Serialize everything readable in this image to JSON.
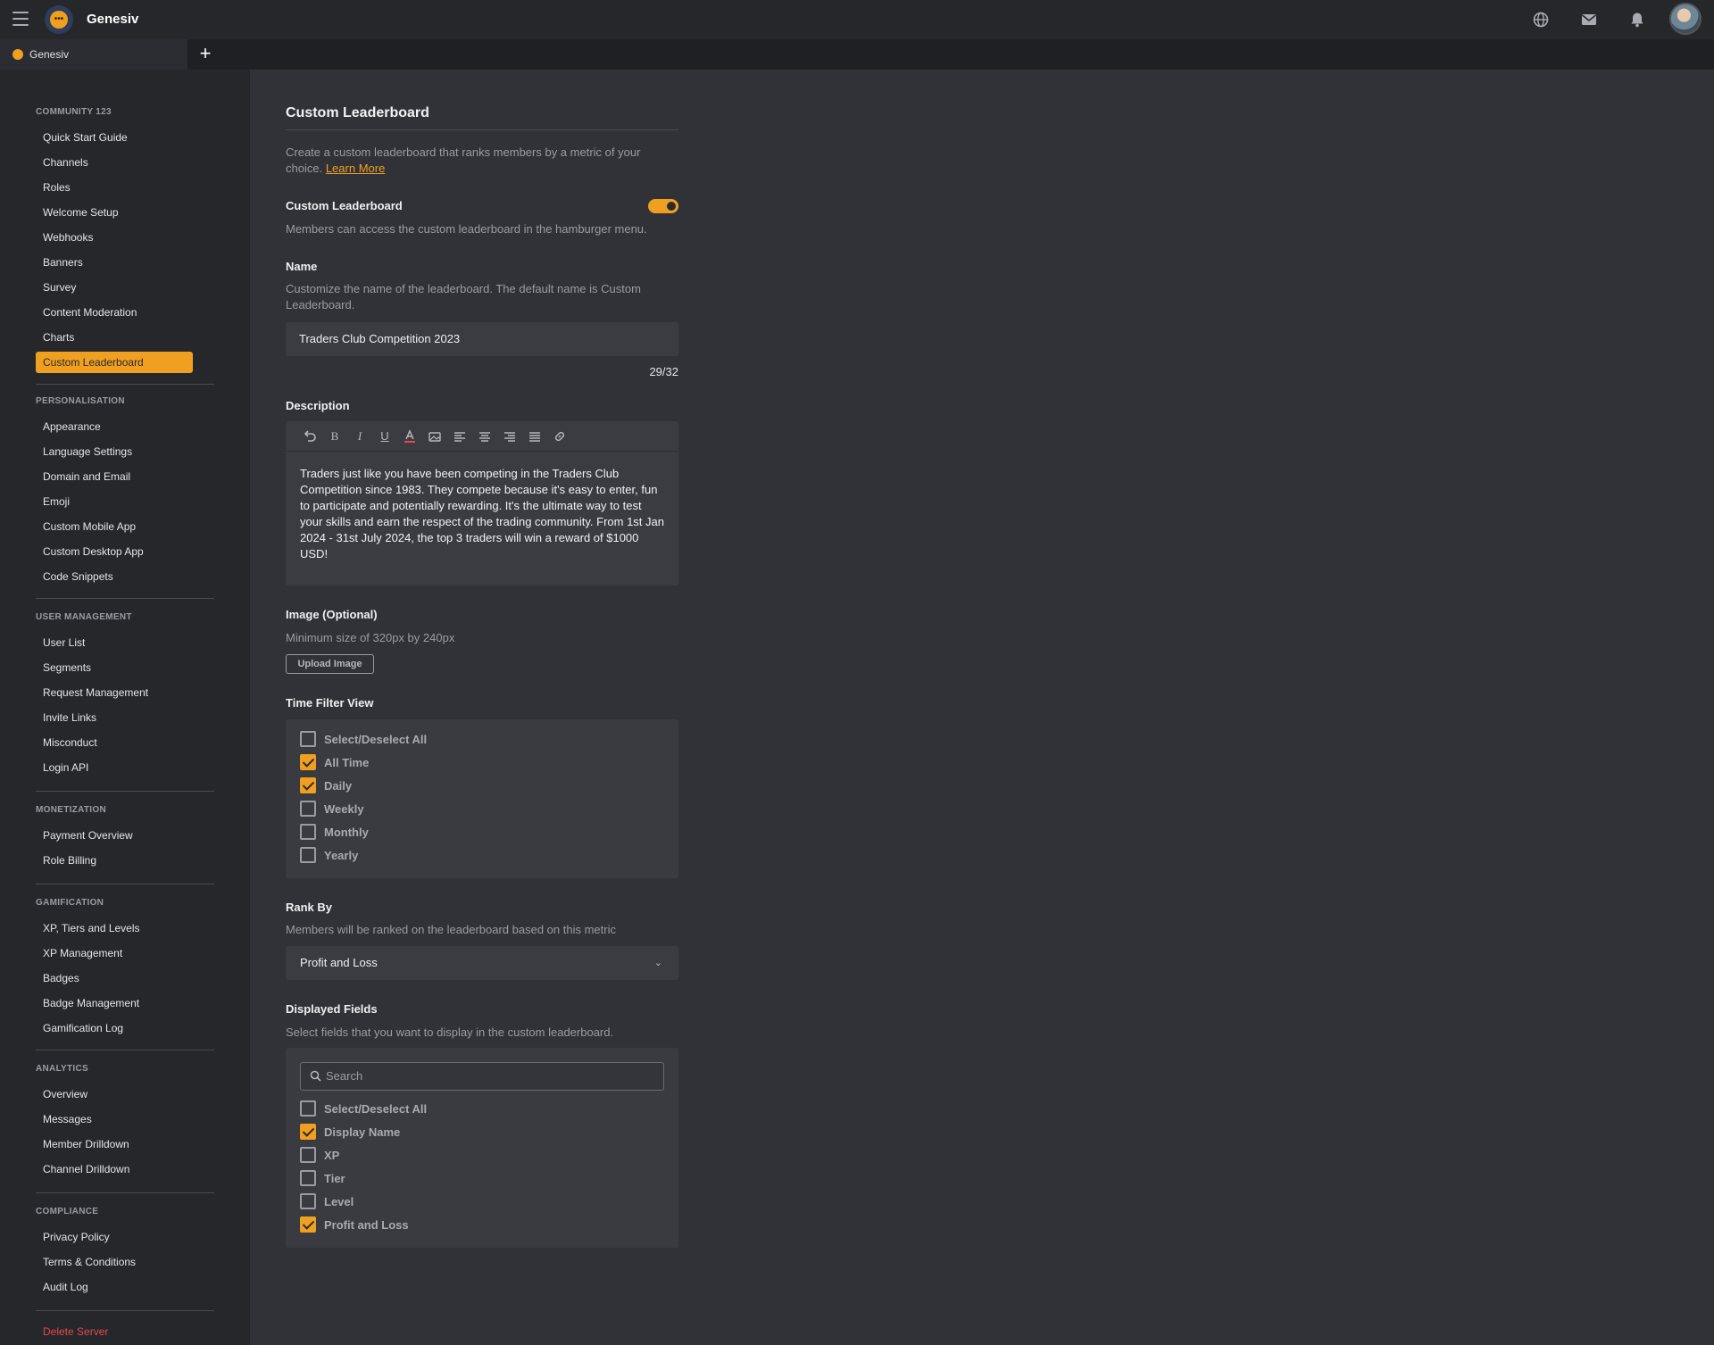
{
  "app": {
    "title": "Genesiv"
  },
  "tabs": [
    {
      "label": "Genesiv"
    }
  ],
  "header_icons": [
    "globe-icon",
    "mail-icon",
    "bell-icon",
    "avatar"
  ],
  "sidebar": {
    "community": {
      "title": "COMMUNITY 123",
      "items": [
        "Quick Start Guide",
        "Channels",
        "Roles",
        "Welcome Setup",
        "Webhooks",
        "Banners",
        "Survey",
        "Content Moderation",
        "Charts",
        "Custom Leaderboard"
      ]
    },
    "personalisation": {
      "title": "PERSONALISATION",
      "items": [
        "Appearance",
        "Language Settings",
        "Domain and Email",
        "Emoji",
        "Custom Mobile App",
        "Custom Desktop App",
        "Code Snippets"
      ]
    },
    "user_management": {
      "title": "USER MANAGEMENT",
      "items": [
        "User List",
        "Segments",
        "Request Management",
        "Invite Links",
        "Misconduct",
        "Login API"
      ]
    },
    "monetization": {
      "title": "MONETIZATION",
      "items": [
        "Payment Overview",
        "Role Billing"
      ]
    },
    "gamification": {
      "title": "GAMIFICATION",
      "items": [
        "XP, Tiers and Levels",
        "XP Management",
        "Badges",
        "Badge Management",
        "Gamification Log"
      ]
    },
    "analytics": {
      "title": "ANALYTICS",
      "items": [
        "Overview",
        "Messages",
        "Member Drilldown",
        "Channel Drilldown"
      ]
    },
    "compliance": {
      "title": "COMPLIANCE",
      "items": [
        "Privacy Policy",
        "Terms & Conditions",
        "Audit Log"
      ]
    },
    "delete": "Delete Server",
    "active_item": "Custom Leaderboard",
    "accent_color": "#f0a020"
  },
  "main": {
    "title": "Custom Leaderboard",
    "intro": "Create a custom leaderboard that ranks members by a metric of your choice.",
    "learn_more": "Learn More",
    "toggle": {
      "label": "Custom Leaderboard",
      "desc": "Members can access the custom leaderboard in the hamburger menu.",
      "enabled": true
    },
    "name": {
      "label": "Name",
      "desc": "Customize the name of the leaderboard. The default name is Custom Leaderboard.",
      "value": "Traders Club Competition 2023",
      "counter": "29/32"
    },
    "description": {
      "label": "Description",
      "toolbar": [
        "undo-icon",
        "bold-icon",
        "italic-icon",
        "underline-icon",
        "text-color-icon",
        "image-icon",
        "align-left-icon",
        "align-center-icon",
        "align-right-icon",
        "justify-icon",
        "link-icon"
      ],
      "text": "Traders just like you have been competing in the Traders Club Competition since 1983. They compete because it's easy to enter, fun to participate and potentially rewarding. It's the ultimate way to test your skills and earn the respect of the trading community. From 1st Jan 2024 - 31st July 2024, the top 3 traders will win a reward of $1000 USD!"
    },
    "image": {
      "label": "Image (Optional)",
      "desc": "Minimum size of 320px by 240px",
      "button": "Upload Image"
    },
    "time_filter": {
      "label": "Time Filter View",
      "options": [
        {
          "label": "Select/Deselect All",
          "checked": false
        },
        {
          "label": "All Time",
          "checked": true
        },
        {
          "label": "Daily",
          "checked": true
        },
        {
          "label": "Weekly",
          "checked": false
        },
        {
          "label": "Monthly",
          "checked": false
        },
        {
          "label": "Yearly",
          "checked": false
        }
      ]
    },
    "rank_by": {
      "label": "Rank By",
      "desc": "Members will be ranked on the leaderboard based on this metric",
      "value": "Profit and Loss"
    },
    "displayed_fields": {
      "label": "Displayed Fields",
      "desc": "Select fields that you want to display in the custom leaderboard.",
      "search_placeholder": "Search",
      "options": [
        {
          "label": "Select/Deselect All",
          "checked": false
        },
        {
          "label": "Display Name",
          "checked": true
        },
        {
          "label": "XP",
          "checked": false
        },
        {
          "label": "Tier",
          "checked": false
        },
        {
          "label": "Level",
          "checked": false
        },
        {
          "label": "Profit and Loss",
          "checked": true
        }
      ]
    }
  }
}
